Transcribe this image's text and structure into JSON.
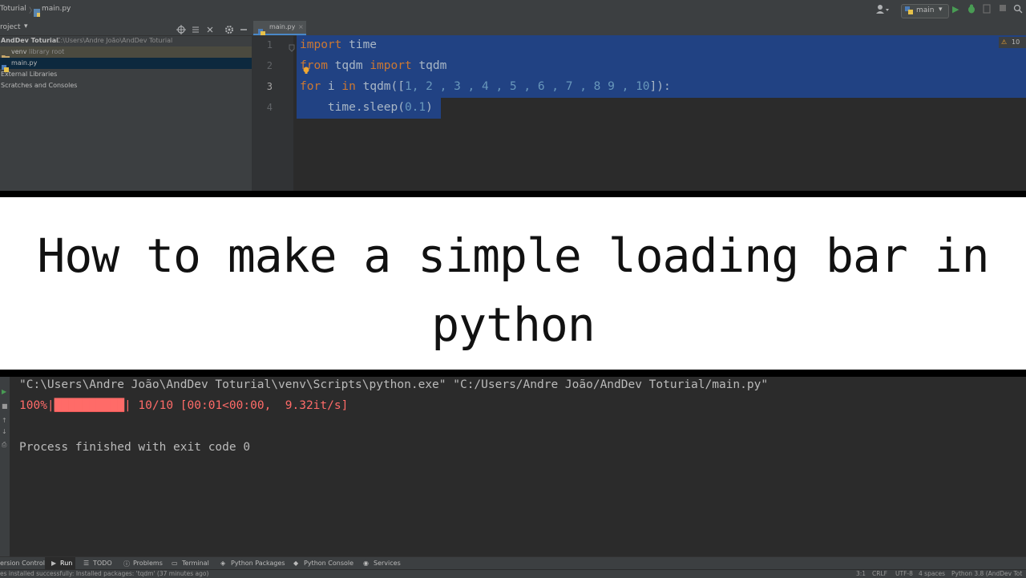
{
  "navbar": {
    "crumb_project": "Toturial",
    "crumb_sep": "〉",
    "crumb_file": "main.py",
    "run_config": "main",
    "colors": {
      "run": "#499c54",
      "debug": "#499c54"
    }
  },
  "project": {
    "header_label": "roject",
    "root_name": "AndDev Toturial",
    "root_path": "C:\\Users\\Andre João\\AndDev Toturial",
    "items": [
      {
        "label": "venv",
        "hint": "library root"
      },
      {
        "label": "main.py"
      },
      {
        "label": "External Libraries"
      },
      {
        "label": "Scratches and Consoles"
      }
    ]
  },
  "editor": {
    "tab_label": "main.py",
    "inspection_badge": "10",
    "line_numbers": [
      "1",
      "2",
      "3",
      "4"
    ],
    "lines": [
      {
        "t1": "import",
        "t2": " time"
      },
      {
        "t1": "from",
        "t2": " tqdm ",
        "t3": "import",
        "t4": " tqdm"
      },
      {
        "t1": "for",
        "t2": " i ",
        "t3": "in",
        "t4": " tqdm([",
        "nums": "1, 2 , 3 , 4 , 5 , 6 , 7 , 8 9 , 10",
        "t5": "]):"
      },
      {
        "t1": "    time.sleep(",
        "n": "0.1",
        "t2": ")"
      }
    ]
  },
  "banner": {
    "title_line1": "How to make a simple loading bar in",
    "title_line2": "python"
  },
  "console": {
    "command": "\"C:\\Users\\Andre João\\AndDev Toturial\\venv\\Scripts\\python.exe\" \"C:/Users/Andre João/AndDev Toturial/main.py\"",
    "progress_pct": "100%|",
    "progress_bar": "██████████",
    "progress_rest": "| 10/10 [00:01<00:00,  9.32it/s]",
    "progress_fraction": 1.0,
    "exit_text": "Process finished with exit code 0",
    "colors": {
      "stderr": "#ff6b68",
      "text": "#bbbbbb"
    }
  },
  "toolbar": {
    "items": [
      "ersion Control",
      "Run",
      "TODO",
      "Problems",
      "Terminal",
      "Python Packages",
      "Python Console",
      "Services"
    ]
  },
  "status": {
    "message": "es installed successfully: Installed packages: 'tqdm' (37 minutes ago)",
    "position": "3:1",
    "line_sep": "CRLF",
    "encoding": "UTF-8",
    "indent": "4 spaces",
    "interpreter": "Python 3.8 (AndDev Tot"
  }
}
